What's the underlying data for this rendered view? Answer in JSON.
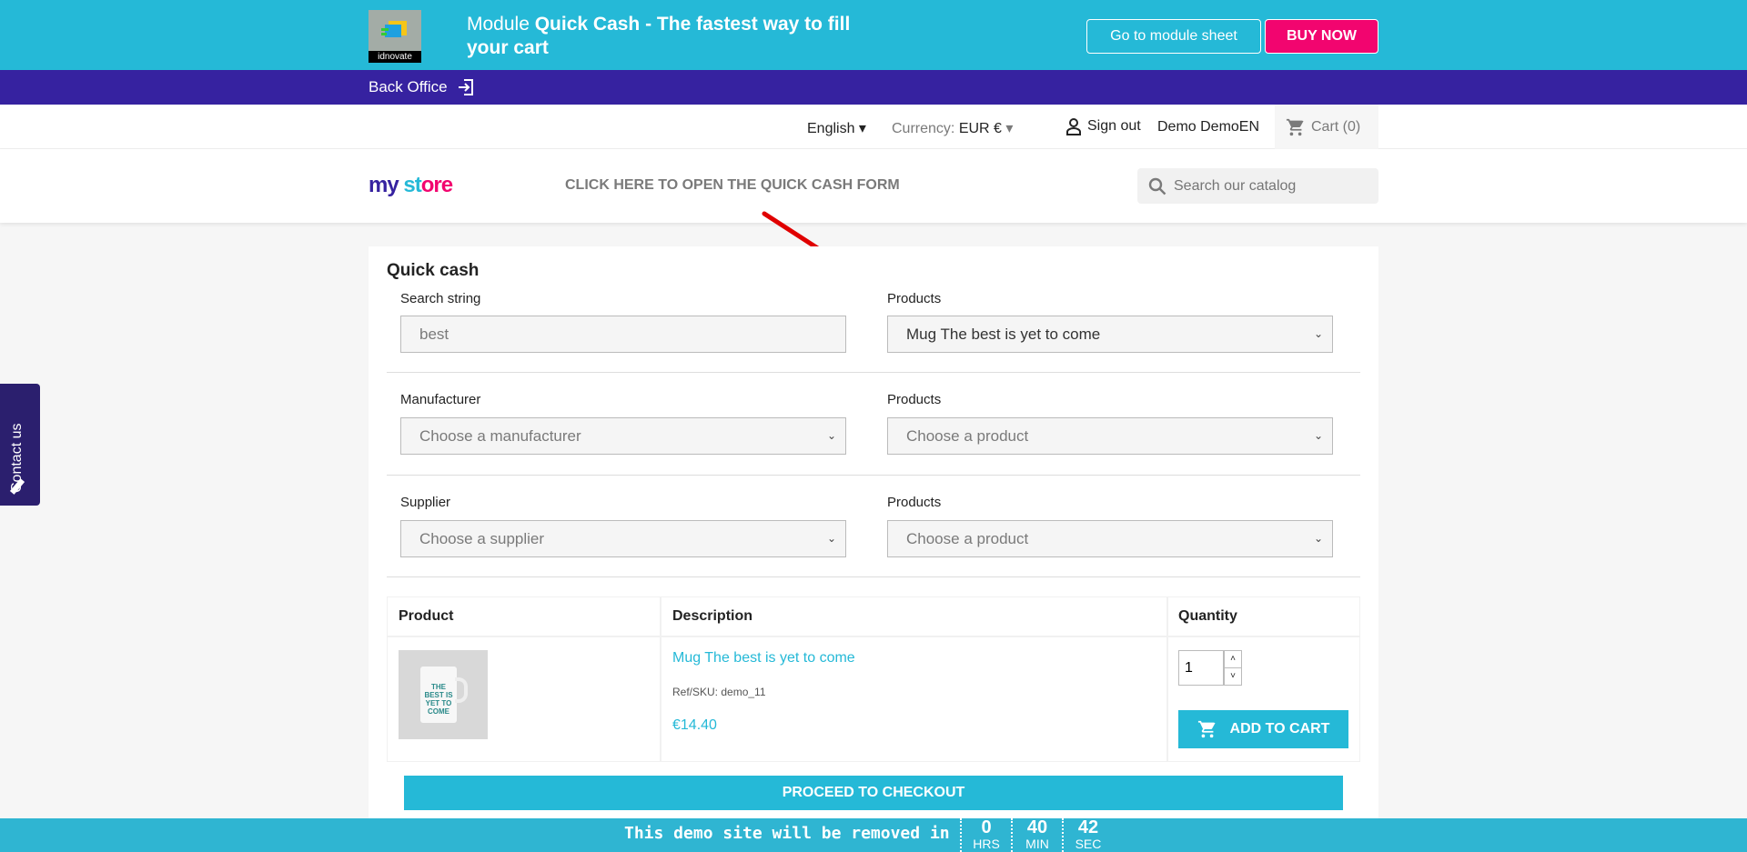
{
  "banner": {
    "logo_text": "idnovate",
    "title_prefix": "Module ",
    "title_bold": "Quick Cash - The fastest way to fill your cart",
    "module_sheet": "Go to module sheet",
    "buy_now": "BUY NOW"
  },
  "backoffice": {
    "label": "Back Office",
    "icon": "sign-in-icon"
  },
  "nav": {
    "language": "English",
    "currency_label": "Currency:",
    "currency": "EUR €",
    "sign_out": "Sign out",
    "user": "Demo DemoEN",
    "cart": "Cart (0)"
  },
  "header": {
    "logo": "my store",
    "quick_cash_link": "CLICK HERE TO OPEN THE QUICK CASH FORM",
    "search_placeholder": "Search our catalog"
  },
  "contact": {
    "label": "Contact us"
  },
  "quickcash": {
    "title": "Quick cash",
    "search_label": "Search string",
    "search_value": "best",
    "products_label": "Products",
    "products_selected": "Mug The best is yet to come",
    "manufacturer_label": "Manufacturer",
    "manufacturer_selected": "Choose a manufacturer",
    "products2_label": "Products",
    "products2_selected": "Choose a product",
    "supplier_label": "Supplier",
    "supplier_selected": "Choose a supplier",
    "products3_label": "Products",
    "products3_selected": "Choose a product",
    "table": {
      "headers": [
        "Product",
        "Description",
        "Quantity"
      ],
      "row": {
        "image_text": "THE BEST IS YET TO COME",
        "name": "Mug The best is yet to come",
        "ref": "Ref/SKU: demo_11",
        "price": "€14.40",
        "quantity": "1",
        "add_to_cart": "ADD TO CART"
      }
    },
    "checkout": "PROCEED TO CHECKOUT"
  },
  "footer": {
    "text": "This demo site will be removed in",
    "hrs": "0",
    "hrs_label": "HRS",
    "min": "40",
    "min_label": "MIN",
    "sec": "42",
    "sec_label": "SEC"
  },
  "colors": {
    "primary": "#25b9d7",
    "purple": "#3622a0",
    "buy": "#f2056f",
    "arrow": "#e00000"
  }
}
